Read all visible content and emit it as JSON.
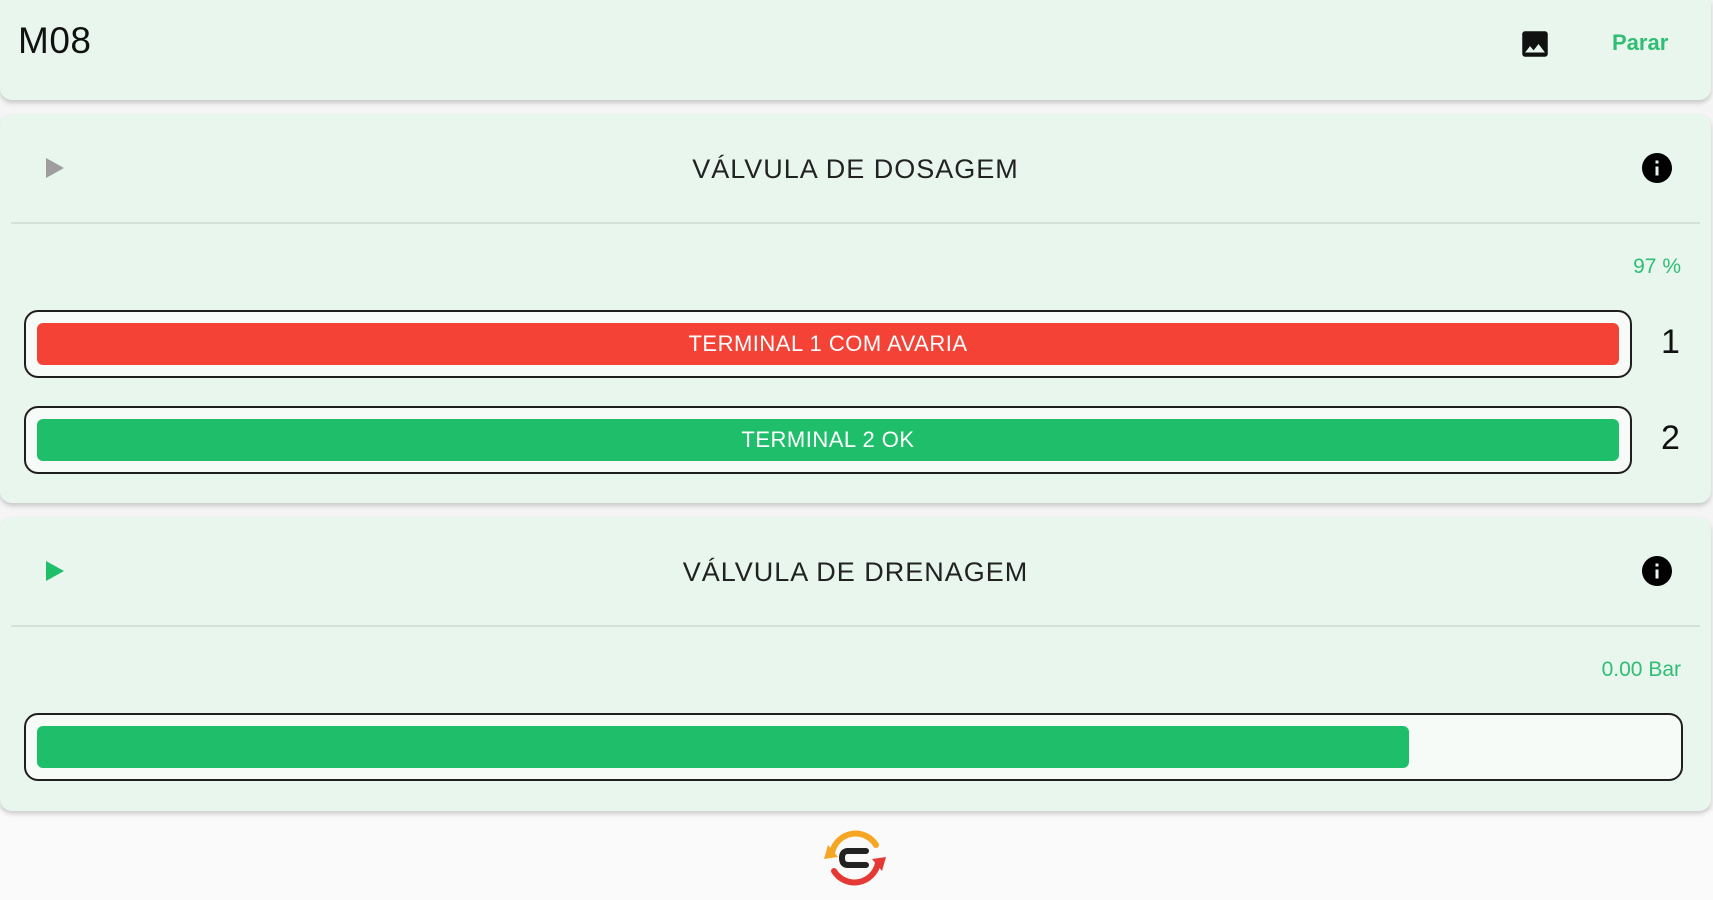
{
  "appbar": {
    "title": "M08",
    "image_icon": "image-icon",
    "stop_label": "Parar"
  },
  "cards": [
    {
      "title": "VÁLVULA DE DOSAGEM",
      "play_icon": "play-icon",
      "play_color": "#9e9e9e",
      "info_icon": "info-icon",
      "reading": "97 %",
      "bars": [
        {
          "label": "TERMINAL 1 COM AVARIA",
          "index": "1",
          "color": "#f44336",
          "fill_fraction": 1.0
        },
        {
          "label": "TERMINAL 2 OK",
          "index": "2",
          "color": "#1fbe6b",
          "fill_fraction": 1.0
        }
      ]
    },
    {
      "title": "VÁLVULA DE DRENAGEM",
      "play_icon": "play-icon",
      "play_color": "#1fbe6b",
      "info_icon": "info-icon",
      "reading": "0.00 Bar",
      "bars": [
        {
          "label": "",
          "index": "",
          "color": "#1fbe6b",
          "fill_fraction": 0.84
        }
      ]
    }
  ],
  "footer": {
    "logo_icon": "app-logo-icon"
  },
  "colors": {
    "accent": "#2fbe73",
    "card_background": "#e8f6ee",
    "alarm": "#f44336",
    "ok": "#1fbe6b"
  }
}
